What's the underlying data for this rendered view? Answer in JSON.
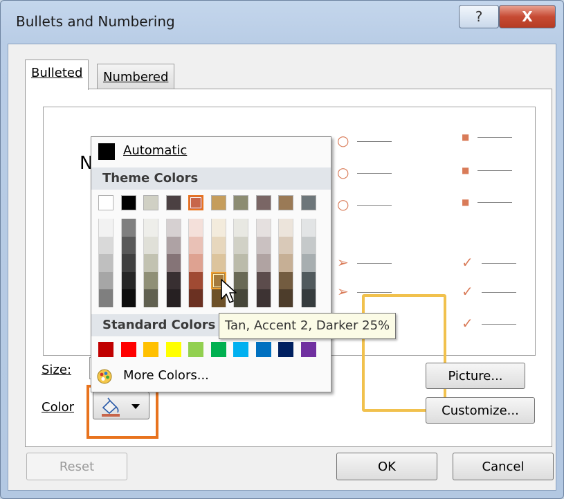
{
  "window": {
    "title": "Bullets and Numbering",
    "help_glyph": "?",
    "close_glyph": "X"
  },
  "tabs": [
    {
      "label": "Bulleted",
      "mnemonic_index": 0,
      "selected": true
    },
    {
      "label": "Numbered",
      "mnemonic_index": 0,
      "selected": false
    }
  ],
  "preview": {
    "partial_letter": "N",
    "bullet_glyphs": {
      "circle": "○",
      "square": "■",
      "arrow": "➢",
      "check": "✓"
    }
  },
  "size": {
    "label": "Size:"
  },
  "color": {
    "label": "Color"
  },
  "buttons": {
    "picture": "Picture...",
    "customize": "Customize...",
    "reset": "Reset",
    "ok": "OK",
    "cancel": "Cancel"
  },
  "color_menu": {
    "automatic": "Automatic",
    "theme_header": "Theme Colors",
    "standard_header": "Standard Colors",
    "more_colors": "More Colors...",
    "theme_colors": [
      [
        "#ffffff",
        "#f2f2f2",
        "#d9d9d9",
        "#bfbfbf",
        "#a6a6a6",
        "#7f7f7f"
      ],
      [
        "#000000",
        "#7f7f7f",
        "#595959",
        "#404040",
        "#262626",
        "#0d0d0d"
      ],
      [
        "#d0d0c4",
        "#eeeeea",
        "#e0e0d8",
        "#c2c2b1",
        "#8f8f76",
        "#606050"
      ],
      [
        "#4b4042",
        "#d6d0d1",
        "#aea2a4",
        "#857477",
        "#382f31",
        "#262022"
      ],
      [
        "#c7654a",
        "#f4e0da",
        "#e9c1b6",
        "#dea291",
        "#a04a33",
        "#6b3122"
      ],
      [
        "#c59d5c",
        "#f3ebdc",
        "#e7d7bd",
        "#dcc49d",
        "#a47a3d",
        "#6d5128"
      ],
      [
        "#8c8c72",
        "#e8e8e2",
        "#d1d1c6",
        "#bbbbaa",
        "#696955",
        "#464639"
      ],
      [
        "#7a6665",
        "#e5e0df",
        "#cac1c1",
        "#b0a3a2",
        "#5c4c4c",
        "#3d3333"
      ],
      [
        "#9a7a56",
        "#ece4db",
        "#d9c9b8",
        "#c6af95",
        "#735c40",
        "#4d3d2b"
      ],
      [
        "#6d767a",
        "#e2e4e5",
        "#c5c9ca",
        "#a7aeb0",
        "#515a5d",
        "#363c3e"
      ]
    ],
    "standard_colors": [
      "#c00000",
      "#ff0000",
      "#ffc000",
      "#ffff00",
      "#92d050",
      "#00b050",
      "#00b0f0",
      "#0070c0",
      "#002060",
      "#7030a0"
    ],
    "selected_theme": {
      "column": 4,
      "row": 0
    },
    "hover_theme": {
      "column": 5,
      "row": 4
    }
  },
  "tooltip": {
    "text": "Tan, Accent 2, Darker 25%"
  },
  "accent_colors": {
    "bullet": "#d97b58",
    "highlight_frame": "#e8731e",
    "selection_box": "#f1c14d"
  }
}
